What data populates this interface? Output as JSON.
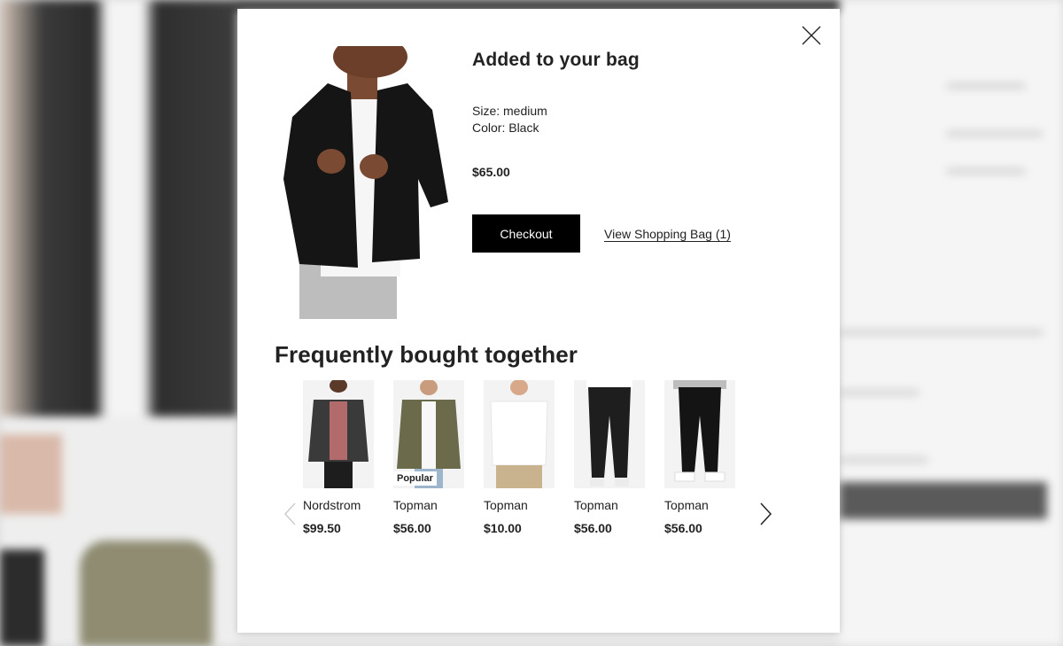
{
  "modal": {
    "title": "Added to your bag",
    "size": "Size: medium",
    "color": "Color: Black",
    "price": "$65.00",
    "checkout_label": "Checkout",
    "view_bag_label": "View Shopping Bag (1)"
  },
  "recommendations": {
    "title": "Frequently bought together",
    "items": [
      {
        "brand": "Nordstrom",
        "price": "$99.50",
        "badge": ""
      },
      {
        "brand": "Topman",
        "price": "$56.00",
        "badge": "Popular"
      },
      {
        "brand": "Topman",
        "price": "$10.00",
        "badge": ""
      },
      {
        "brand": "Topman",
        "price": "$56.00",
        "badge": ""
      },
      {
        "brand": "Topman",
        "price": "$56.00",
        "badge": ""
      }
    ]
  },
  "icons": {
    "close": "close-icon",
    "prev": "chevron-left-icon",
    "next": "chevron-right-icon"
  },
  "colors": {
    "button_bg": "#000000",
    "text": "#222222",
    "backdrop": "#dcdcdc"
  }
}
